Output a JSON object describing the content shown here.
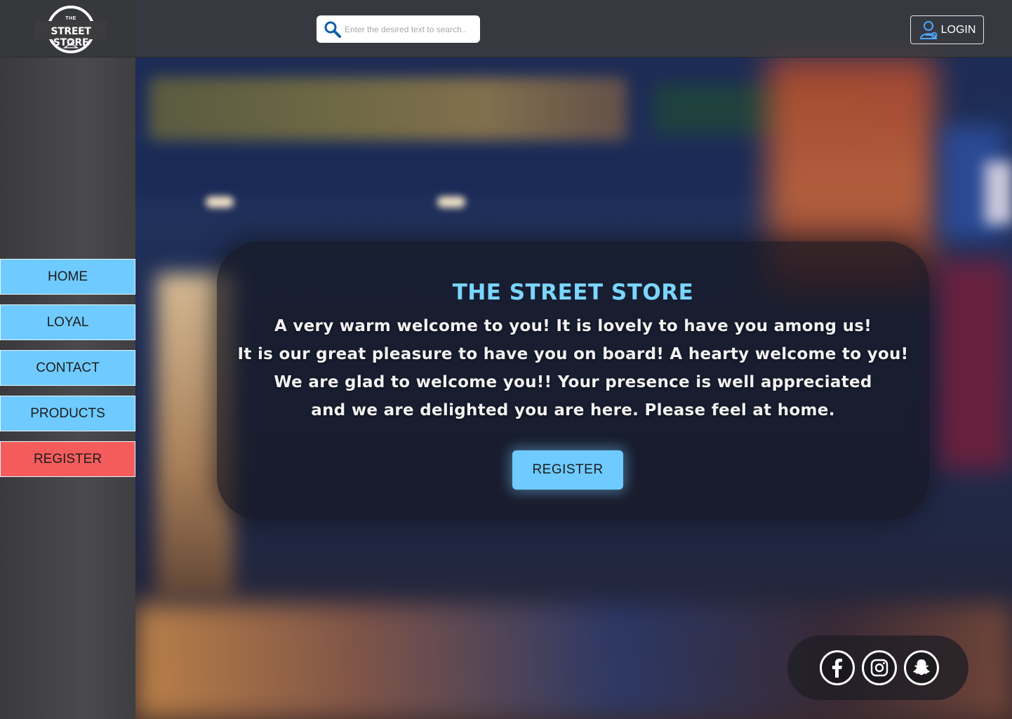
{
  "brand": {
    "logo_small": "THE",
    "logo_big": "STREET STORE"
  },
  "search": {
    "placeholder": "Enter the desired text to search.."
  },
  "header": {
    "login_label": "LOGIN"
  },
  "sidebar": {
    "items": [
      {
        "label": "HOME"
      },
      {
        "label": "LOYAL"
      },
      {
        "label": "CONTACT"
      },
      {
        "label": "PRODUCTS"
      },
      {
        "label": "REGISTER"
      }
    ]
  },
  "welcome": {
    "title": "THE STREET STORE",
    "lines": [
      "A very warm welcome to you! It is lovely to have you among us!",
      "It is our great pleasure to have you on board! A hearty welcome to you!",
      "We are glad to welcome you!! Your presence is well appreciated",
      "and we are delighted you are here. Please feel at home."
    ],
    "register_label": "REGISTER"
  },
  "social": {
    "icons": [
      "facebook-icon",
      "instagram-icon",
      "snapchat-icon"
    ]
  },
  "colors": {
    "accent_blue": "#6fcbff",
    "title_blue": "#7ad6ff",
    "register_red": "#f45c5c",
    "login_icon_blue": "#4aa8ff"
  }
}
